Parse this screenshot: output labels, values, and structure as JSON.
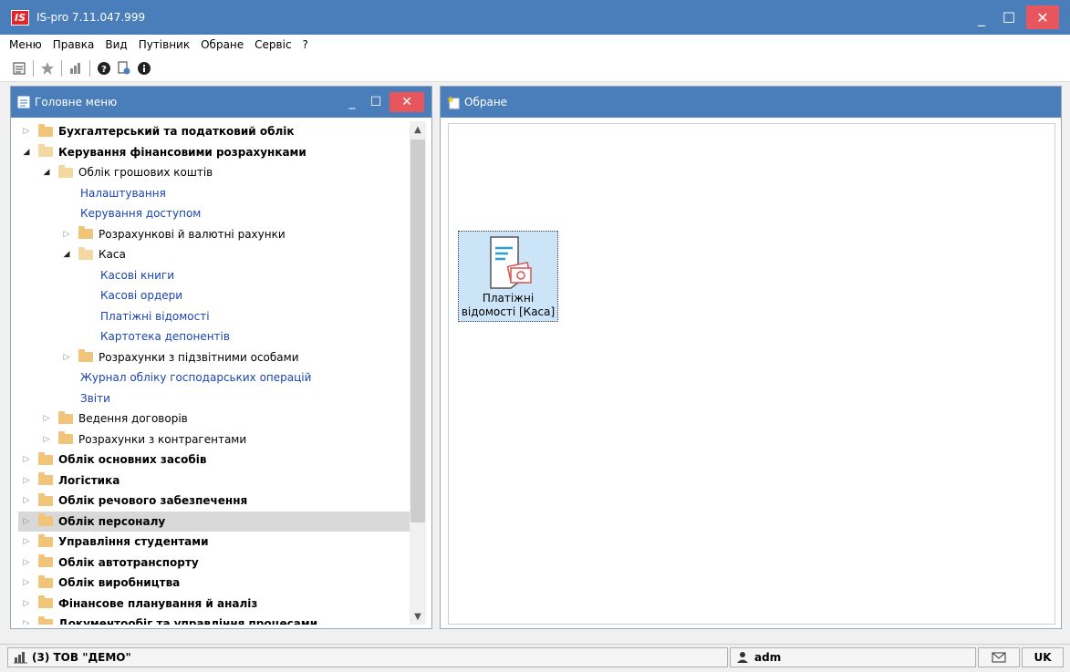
{
  "window": {
    "logo": "IS",
    "title": "IS-pro 7.11.047.999",
    "minimize": "_",
    "maximize": "☐",
    "close": "✕"
  },
  "menu": [
    "Меню",
    "Правка",
    "Вид",
    "Путівник",
    "Обране",
    "Сервіс",
    "?"
  ],
  "left_panel": {
    "title": "Головне меню",
    "minimize": "_",
    "maximize": "☐",
    "close": "✕",
    "tree": [
      {
        "label": "Бухгалтерський та податковий облік",
        "level": 0,
        "type": "folder",
        "expanded": false,
        "bold": true
      },
      {
        "label": "Керування фінансовими розрахунками",
        "level": 0,
        "type": "folder",
        "expanded": true,
        "bold": true
      },
      {
        "label": "Облік грошових коштів",
        "level": 1,
        "type": "folder",
        "expanded": true,
        "bold": false
      },
      {
        "label": "Налаштування",
        "level": 2,
        "type": "link"
      },
      {
        "label": "Керування доступом",
        "level": 2,
        "type": "link"
      },
      {
        "label": "Розрахункові й валютні рахунки",
        "level": 2,
        "type": "folder",
        "expanded": false,
        "bold": false
      },
      {
        "label": "Каса",
        "level": 2,
        "type": "folder",
        "expanded": true,
        "bold": false
      },
      {
        "label": "Касові книги",
        "level": 3,
        "type": "link"
      },
      {
        "label": "Касові ордери",
        "level": 3,
        "type": "link"
      },
      {
        "label": "Платіжні відомості",
        "level": 3,
        "type": "link"
      },
      {
        "label": "Картотека депонентів",
        "level": 3,
        "type": "link"
      },
      {
        "label": "Розрахунки з підзвітними особами",
        "level": 2,
        "type": "folder",
        "expanded": false,
        "bold": false
      },
      {
        "label": "Журнал обліку господарських операцій",
        "level": 2,
        "type": "link"
      },
      {
        "label": "Звіти",
        "level": 2,
        "type": "link"
      },
      {
        "label": "Ведення договорів",
        "level": 1,
        "type": "folder",
        "expanded": false,
        "bold": false
      },
      {
        "label": "Розрахунки з контрагентами",
        "level": 1,
        "type": "folder",
        "expanded": false,
        "bold": false
      },
      {
        "label": "Облік основних засобів",
        "level": 0,
        "type": "folder",
        "expanded": false,
        "bold": true
      },
      {
        "label": "Логістика",
        "level": 0,
        "type": "folder",
        "expanded": false,
        "bold": true
      },
      {
        "label": "Облік речового забезпечення",
        "level": 0,
        "type": "folder",
        "expanded": false,
        "bold": true
      },
      {
        "label": "Облік персоналу",
        "level": 0,
        "type": "folder",
        "expanded": false,
        "bold": true,
        "selected": true
      },
      {
        "label": "Управління студентами",
        "level": 0,
        "type": "folder",
        "expanded": false,
        "bold": true
      },
      {
        "label": "Облік автотранспорту",
        "level": 0,
        "type": "folder",
        "expanded": false,
        "bold": true
      },
      {
        "label": "Облік виробництва",
        "level": 0,
        "type": "folder",
        "expanded": false,
        "bold": true
      },
      {
        "label": "Фінансове планування й аналіз",
        "level": 0,
        "type": "folder",
        "expanded": false,
        "bold": true
      },
      {
        "label": "Документообіг та управління процесами",
        "level": 0,
        "type": "folder",
        "expanded": false,
        "bold": true
      }
    ]
  },
  "right_panel": {
    "title": "Обране",
    "tiles": [
      {
        "label_line1": "Платіжні",
        "label_line2": "відомості [Каса]",
        "icon": "payment-document-icon"
      }
    ]
  },
  "status": {
    "org": "(3) ТОВ \"ДЕМО\"",
    "user": "adm",
    "lang": "UK"
  },
  "colors": {
    "titlebar": "#4a7ebb",
    "close": "#e8565d",
    "link": "#1a44b0",
    "folder": "#f0c57a"
  }
}
